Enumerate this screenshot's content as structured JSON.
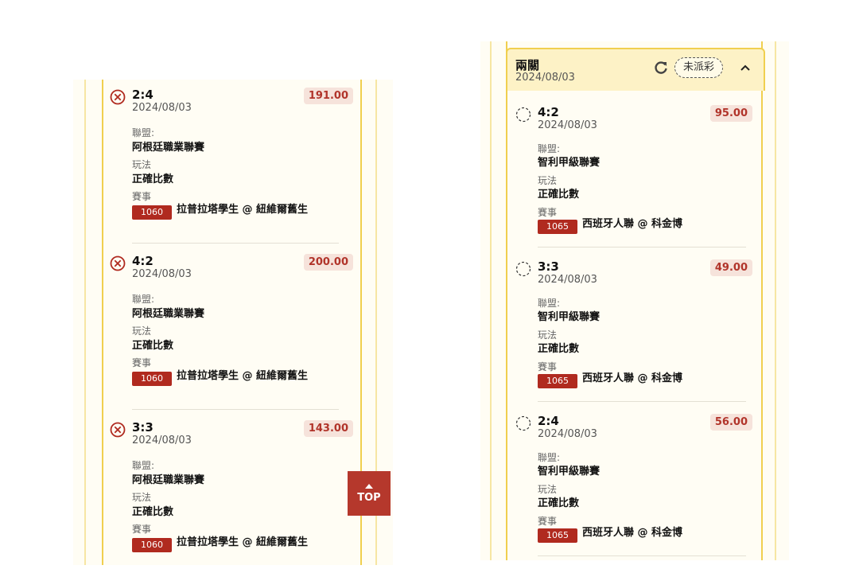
{
  "labels": {
    "league": "聯盟:",
    "play": "玩法",
    "match": "賽事"
  },
  "top_button": "TOP",
  "colors": {
    "accent": "#b02a1f",
    "border": "#f0cf4f",
    "panel": "#fffdf4",
    "odds_bg": "#f6e3db"
  },
  "left_bets": [
    {
      "score": "2:4",
      "date": "2024/08/03",
      "odds": "191.00",
      "league": "阿根廷職業聯賽",
      "play": "正確比數",
      "match_id": "1060",
      "match": "拉普拉塔學生 @ 紐維爾舊生",
      "status_icon": "lost-x-icon"
    },
    {
      "score": "4:2",
      "date": "2024/08/03",
      "odds": "200.00",
      "league": "阿根廷職業聯賽",
      "play": "正確比數",
      "match_id": "1060",
      "match": "拉普拉塔學生 @ 紐維爾舊生",
      "status_icon": "lost-x-icon"
    },
    {
      "score": "3:3",
      "date": "2024/08/03",
      "odds": "143.00",
      "league": "阿根廷職業聯賽",
      "play": "正確比數",
      "match_id": "1060",
      "match": "拉普拉塔學生 @ 紐維爾舊生",
      "status_icon": "lost-x-icon"
    }
  ],
  "right_card": {
    "title": "兩關",
    "date": "2024/08/03",
    "status": "未派彩",
    "bets": [
      {
        "score": "4:2",
        "date": "2024/08/03",
        "odds": "95.00",
        "league": "智利甲級聯賽",
        "play": "正確比數",
        "match_id": "1065",
        "match": "西班牙人聯 @ 科金博",
        "status_icon": "pending-dashed-circle-icon"
      },
      {
        "score": "3:3",
        "date": "2024/08/03",
        "odds": "49.00",
        "league": "智利甲級聯賽",
        "play": "正確比數",
        "match_id": "1065",
        "match": "西班牙人聯 @ 科金博",
        "status_icon": "pending-dashed-circle-icon"
      },
      {
        "score": "2:4",
        "date": "2024/08/03",
        "odds": "56.00",
        "league": "智利甲級聯賽",
        "play": "正確比數",
        "match_id": "1065",
        "match": "西班牙人聯 @ 科金博",
        "status_icon": "pending-dashed-circle-icon"
      }
    ]
  }
}
